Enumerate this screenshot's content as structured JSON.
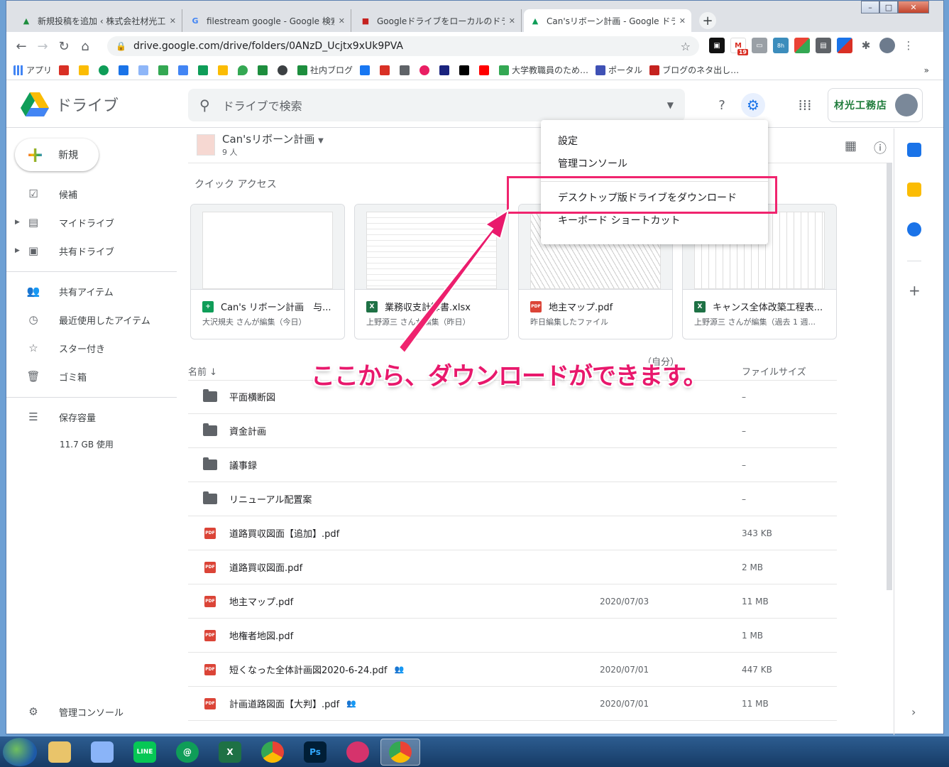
{
  "tabs": [
    {
      "title": "新規投稿を追加 ‹ 株式会社材光工",
      "icon": "wordpress-icon",
      "color": "#1e8e3e"
    },
    {
      "title": "filestream google - Google 検索",
      "icon": "google-icon",
      "color": "#4285f4"
    },
    {
      "title": "Googleドライブをローカルのドライ",
      "icon": "blog-icon",
      "color": "#c5221f"
    },
    {
      "title": "Can'sリボーン計画 - Google ドライ",
      "icon": "drive-icon",
      "color": "#0f9d58"
    }
  ],
  "window_controls": {
    "minimize": "–",
    "maximize": "□",
    "close": "✕"
  },
  "address": {
    "url": "drive.google.com/drive/folders/0ANzD_Ucjtx9xUk9PVA"
  },
  "extensions": {
    "gmail_badge": "19",
    "timer_badge": "8h"
  },
  "bookmarks": [
    "アプリ",
    "社内ブログ",
    "大学教職員のため…",
    "ポータル",
    "ブログのネタ出し…"
  ],
  "bookmark_more": "»",
  "drive": {
    "logo_text": "ドライブ",
    "search_placeholder": "ドライブで検索",
    "brand_text": "材光工務店",
    "new_label": "新規",
    "nav": [
      {
        "label": "候補",
        "icon": "check-circle-icon"
      },
      {
        "label": "マイドライブ",
        "icon": "my-drive-icon"
      },
      {
        "label": "共有ドライブ",
        "icon": "shared-drive-icon"
      },
      {
        "label": "共有アイテム",
        "icon": "people-icon"
      },
      {
        "label": "最近使用したアイテム",
        "icon": "clock-icon"
      },
      {
        "label": "スター付き",
        "icon": "star-icon"
      },
      {
        "label": "ゴミ箱",
        "icon": "trash-icon"
      },
      {
        "label": "保存容量",
        "icon": "storage-icon"
      }
    ],
    "storage_used": "11.7 GB 使用",
    "admin_console": "管理コンソール",
    "folder": {
      "name": "Can'sリボーン計画",
      "members": "9 人"
    },
    "quick_access_title": "クイック アクセス",
    "quick_access": [
      {
        "title": "Can's リボーン計画　与...",
        "sub": "大沢規夫 さんが編集（今日）",
        "type": "sheet"
      },
      {
        "title": "業務収支計算書.xlsx",
        "sub": "上野源三 さんが編集（昨日）",
        "type": "xls"
      },
      {
        "title": "地主マップ.pdf",
        "sub": "昨日編集したファイル",
        "type": "pdf"
      },
      {
        "title": "キャンス全体改築工程表...",
        "sub": "上野源三 さんが編集（過去 1 週...",
        "type": "xls"
      }
    ],
    "list_headers": {
      "name": "名前",
      "modified": "（自分）",
      "size": "ファイルサイズ"
    },
    "files": [
      {
        "name": "平面横断図",
        "type": "folder",
        "date": "",
        "size": "–",
        "shared": false
      },
      {
        "name": "資金計画",
        "type": "folder",
        "date": "",
        "size": "–",
        "shared": false
      },
      {
        "name": "議事録",
        "type": "folder",
        "date": "",
        "size": "–",
        "shared": false
      },
      {
        "name": "リニューアル配置案",
        "type": "folder",
        "date": "",
        "size": "–",
        "shared": false
      },
      {
        "name": "道路買収図面【追加】.pdf",
        "type": "pdf",
        "date": "",
        "size": "343 KB",
        "shared": false
      },
      {
        "name": "道路買収図面.pdf",
        "type": "pdf",
        "date": "",
        "size": "2 MB",
        "shared": false
      },
      {
        "name": "地主マップ.pdf",
        "type": "pdf",
        "date": "2020/07/03",
        "size": "11 MB",
        "shared": false
      },
      {
        "name": "地権者地図.pdf",
        "type": "pdf",
        "date": "",
        "size": "1 MB",
        "shared": false
      },
      {
        "name": "短くなった全体計画図2020-6-24.pdf",
        "type": "pdf",
        "date": "2020/07/01",
        "size": "447 KB",
        "shared": true
      },
      {
        "name": "計画道路図面【大判】.pdf",
        "type": "pdf",
        "date": "2020/07/01",
        "size": "11 MB",
        "shared": true
      }
    ],
    "pdf_badge": "PDF",
    "xls_badge": "X"
  },
  "settings_menu": [
    "設定",
    "管理コンソール",
    "デスクトップ版ドライブをダウンロード",
    "キーボード ショートカット"
  ],
  "annotation": "ここから、ダウンロードができます。",
  "accent_color": "#f0246e",
  "taskbar_labels": {
    "excel": "X",
    "photoshop": "Ps",
    "line": "LINE"
  }
}
